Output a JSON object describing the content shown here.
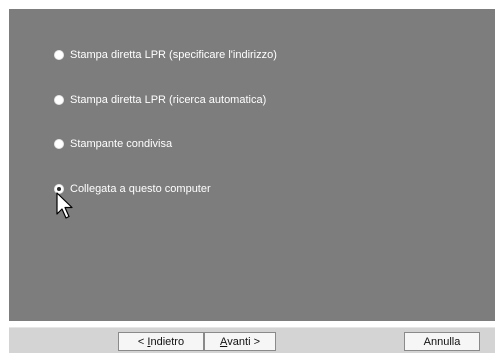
{
  "options": [
    {
      "label": "Stampa diretta LPR (specificare l'indirizzo)",
      "checked": false
    },
    {
      "label": "Stampa diretta LPR (ricerca automatica)",
      "checked": false
    },
    {
      "label": "Stampante condivisa",
      "checked": false
    },
    {
      "label": "Collegata a questo computer",
      "checked": true
    }
  ],
  "buttons": {
    "back": {
      "prefix": "< ",
      "mnemonic": "I",
      "rest": "ndietro"
    },
    "next": {
      "mnemonic": "A",
      "rest": "vanti",
      "suffix": " >"
    },
    "cancel": {
      "label": "Annulla"
    }
  },
  "colors": {
    "panel_background": "#7d7d7d",
    "footer_background": "#d4d4d4",
    "option_text": "#ffffff"
  },
  "icons": {
    "cursor": "mouse-pointer-icon"
  }
}
